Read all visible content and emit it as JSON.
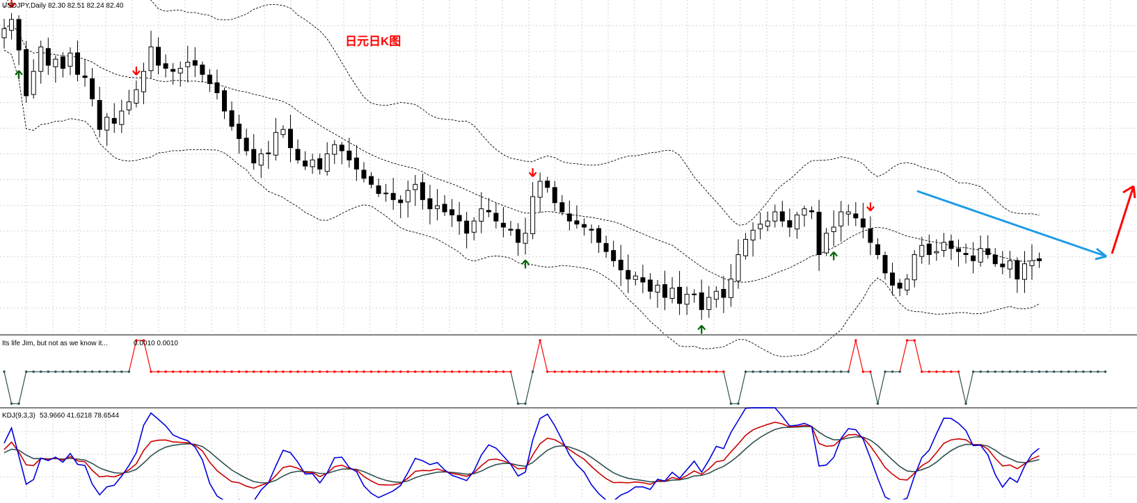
{
  "chart_window": {
    "symbol_label": "USDJPY,Daily",
    "ohlc_text": "82.30 82.51 82.24 82.40",
    "annotation": "日元日K图"
  },
  "colors": {
    "background": "#ffffff",
    "grid": "#c8c8c8",
    "candle": "#000000",
    "band": "#000000",
    "arrow_up": "#006400",
    "arrow_down": "#ff0000",
    "jim_high": "#ff0000",
    "jim_low": "#2f4f4f",
    "kdj_k": "#cc0000",
    "kdj_d": "#2f4f4f",
    "kdj_j": "#0000dd",
    "trend_arrow": "#1e9be6",
    "breakout_arrow": "#ff0000"
  },
  "indicator_jim": {
    "label": "Its life Jim, but not as we know it...",
    "values_text": "0.0010 0.0010"
  },
  "indicator_kdj": {
    "label": "KDJ(9,3,3)",
    "values_text": "53.9660 41.6218 78.6544"
  },
  "chart_data": [
    {
      "type": "candlestick",
      "title": "USDJPY,Daily",
      "note": "日元日K图",
      "close_series": [
        86.6,
        86.9,
        85.9,
        84.4,
        85.2,
        86.0,
        85.4,
        85.6,
        85.3,
        85.8,
        85.1,
        85.0,
        84.3,
        83.3,
        83.7,
        83.5,
        83.9,
        84.2,
        84.6,
        85.2,
        86.0,
        85.4,
        85.3,
        85.2,
        85.3,
        85.5,
        85.4,
        85.1,
        84.8,
        84.5,
        83.9,
        83.4,
        83.0,
        82.6,
        82.2,
        82.5,
        82.5,
        83.2,
        83.3,
        82.7,
        82.3,
        82.1,
        82.3,
        82.0,
        82.5,
        82.8,
        82.6,
        82.3,
        82.0,
        81.7,
        81.5,
        81.2,
        81.2,
        81.0,
        80.9,
        81.3,
        81.5,
        81.0,
        80.7,
        80.8,
        80.6,
        80.5,
        80.3,
        79.9,
        80.3,
        80.7,
        80.6,
        80.3,
        80.1,
        80.0,
        79.6,
        79.9,
        81.1,
        81.6,
        81.4,
        80.9,
        80.6,
        80.3,
        80.2,
        80.1,
        80.0,
        79.6,
        79.3,
        79.0,
        78.7,
        78.4,
        78.5,
        78.3,
        78.0,
        78.2,
        77.8,
        78.1,
        77.6,
        77.9,
        77.9,
        77.4,
        77.8,
        78.0,
        77.8,
        78.4,
        79.2,
        79.7,
        80.0,
        80.2,
        80.3,
        80.6,
        80.3,
        80.1,
        80.5,
        80.7,
        80.6,
        79.2,
        79.9,
        80.1,
        80.6,
        80.6,
        80.4,
        80.1,
        79.6,
        79.2,
        78.6,
        78.2,
        78.1,
        78.4,
        79.2,
        79.5,
        79.2,
        79.3,
        79.6,
        79.4,
        79.3,
        79.2,
        79.0,
        79.4,
        79.2,
        78.9,
        78.8,
        79.0,
        78.4,
        78.9,
        79.0,
        79.0
      ],
      "key_levels": {
        "start": 86.6,
        "high": 87.0,
        "low": 77.2,
        "end": 79.0
      },
      "bollinger_bands": true,
      "fractal_arrows_up_count": 7,
      "fractal_arrows_down_count": 5,
      "grid": true
    },
    {
      "type": "line",
      "title": "Its life Jim, but not as we know it...",
      "values_text": "0.0010 0.0010",
      "state_series": [
        0,
        -1,
        -1,
        0,
        0,
        0,
        0,
        0,
        0,
        0,
        0,
        0,
        0,
        0,
        0,
        0,
        0,
        0,
        1,
        1,
        0,
        0,
        0,
        0,
        0,
        0,
        0,
        0,
        0,
        0,
        0,
        0,
        0,
        0,
        0,
        0,
        0,
        0,
        0,
        0,
        0,
        0,
        0,
        0,
        0,
        0,
        0,
        0,
        0,
        0,
        0,
        0,
        0,
        0,
        0,
        0,
        0,
        0,
        0,
        0,
        0,
        0,
        0,
        0,
        0,
        0,
        0,
        0,
        0,
        0,
        -1,
        -1,
        0,
        1,
        0,
        0,
        0,
        0,
        0,
        0,
        0,
        0,
        0,
        0,
        0,
        0,
        0,
        0,
        0,
        0,
        0,
        0,
        0,
        0,
        0,
        0,
        0,
        0,
        0,
        -1,
        -1,
        0,
        0,
        0,
        0,
        0,
        0,
        0,
        0,
        0,
        0,
        0,
        0,
        0,
        0,
        0,
        1,
        0,
        0,
        -1,
        0,
        0,
        0,
        1,
        1,
        0,
        0,
        0,
        0,
        0,
        0,
        -1,
        0,
        0,
        0,
        0,
        0,
        0,
        0,
        0,
        0,
        0,
        0,
        0,
        0,
        0,
        0,
        0,
        0,
        0,
        0
      ]
    },
    {
      "type": "line",
      "title": "KDJ(9,3,3)",
      "series": [
        {
          "name": "K",
          "last": 53.966
        },
        {
          "name": "D",
          "last": 41.6218
        },
        {
          "name": "J",
          "last": 78.6544
        }
      ],
      "ylim": [
        0,
        100
      ],
      "grid": true
    }
  ]
}
